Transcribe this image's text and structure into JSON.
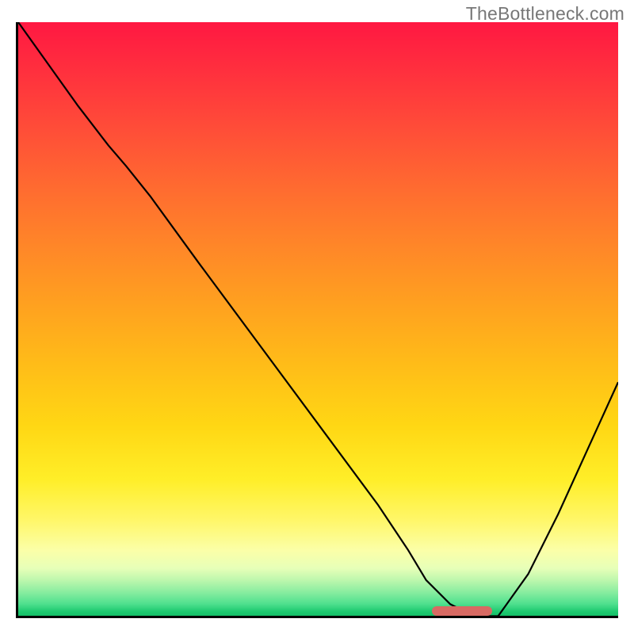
{
  "watermark": "TheBottleneck.com",
  "chart_data": {
    "type": "line",
    "title": "",
    "xlabel": "",
    "ylabel": "",
    "xlim": [
      0,
      100
    ],
    "ylim": [
      0,
      100
    ],
    "grid": false,
    "series": [
      {
        "name": "bottleneck-curve",
        "x": [
          0,
          5,
          10,
          15,
          18,
          22,
          30,
          40,
          50,
          60,
          65,
          68,
          72,
          76,
          80,
          85,
          90,
          95,
          100
        ],
        "values": [
          100,
          93,
          86,
          79.5,
          76,
          71,
          60,
          46.5,
          33,
          19.5,
          12,
          7,
          3,
          1,
          1,
          8,
          18,
          29,
          40
        ]
      }
    ],
    "marker": {
      "name": "optimal-range",
      "x_start": 69,
      "x_end": 79,
      "y": 0.5,
      "color": "#d86a63"
    },
    "gradient_legend": {
      "top_color_meaning": "high-bottleneck",
      "bottom_color_meaning": "no-bottleneck",
      "colors_top_to_bottom": [
        "#ff1842",
        "#ffa21f",
        "#ffee28",
        "#1dc96f"
      ]
    }
  }
}
